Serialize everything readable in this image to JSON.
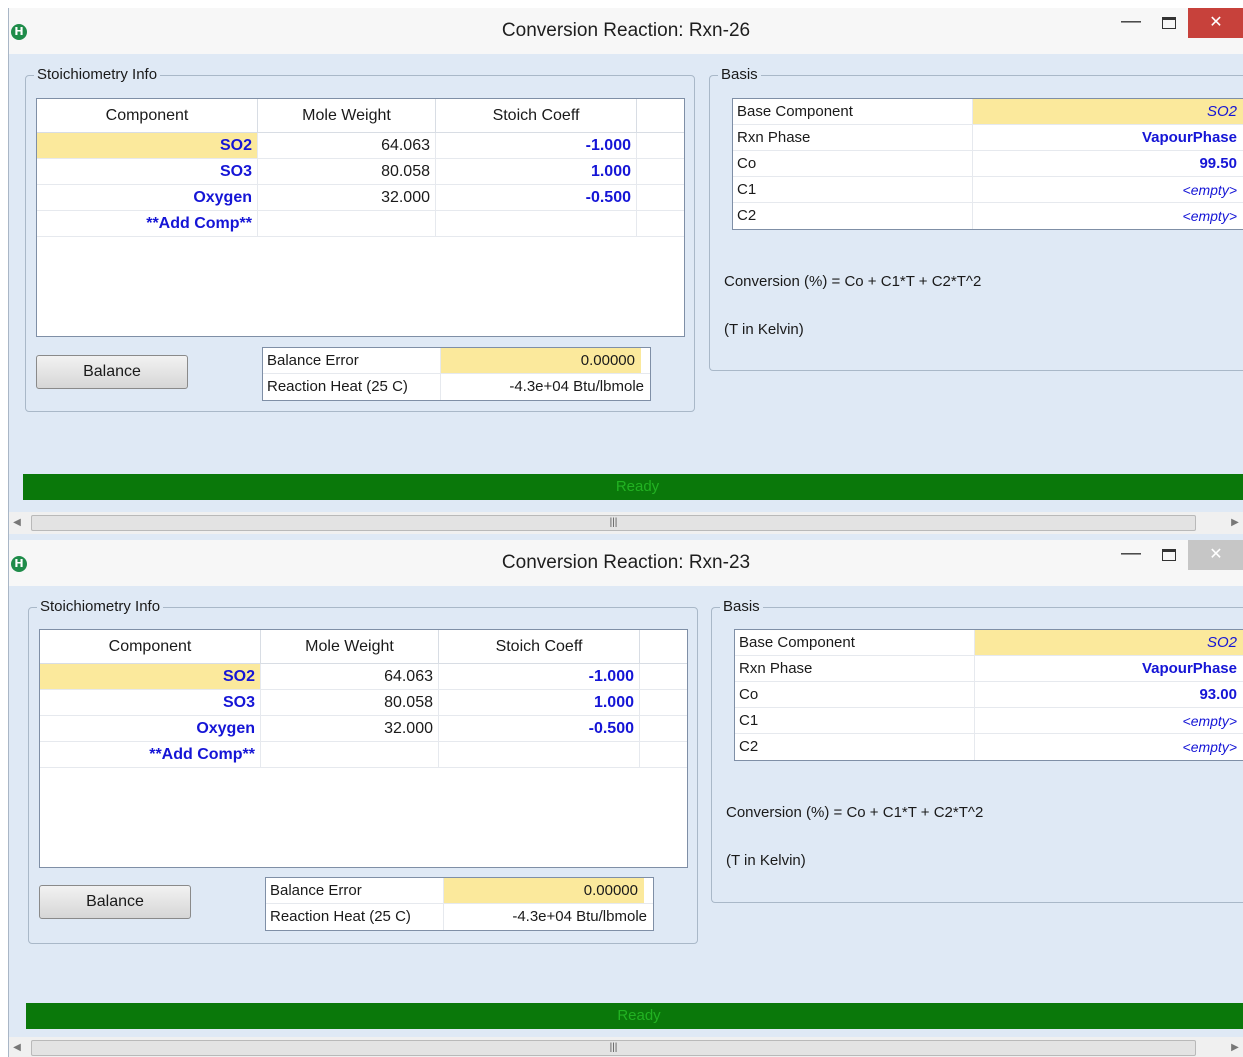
{
  "window1": {
    "title": "Conversion Reaction: Rxn-26",
    "stoich_label": "Stoichiometry Info",
    "grid_headers": [
      "Component",
      "Mole Weight",
      "Stoich Coeff"
    ],
    "rows": [
      {
        "component": "SO2",
        "mw": "64.063",
        "coeff": "-1.000"
      },
      {
        "component": "SO3",
        "mw": "80.058",
        "coeff": "1.000"
      },
      {
        "component": "Oxygen",
        "mw": "32.000",
        "coeff": "-0.500"
      },
      {
        "component": "**Add Comp**",
        "mw": "",
        "coeff": ""
      }
    ],
    "balance_button": "Balance",
    "balance_error_label": "Balance Error",
    "balance_error_value": "0.00000",
    "reaction_heat_label": "Reaction Heat (25 C)",
    "reaction_heat_value": "-4.3e+04 Btu/lbmole",
    "basis_label": "Basis",
    "basis": {
      "base_component_label": "Base Component",
      "base_component_value": "SO2",
      "rxn_phase_label": "Rxn Phase",
      "rxn_phase_value": "VapourPhase",
      "co_label": "Co",
      "co_value": "99.50",
      "c1_label": "C1",
      "c1_value": "<empty>",
      "c2_label": "C2",
      "c2_value": "<empty>"
    },
    "formula": "Conversion (%) = Co + C1*T + C2*T^2",
    "t_note": "(T in Kelvin)",
    "status": "Ready"
  },
  "window2": {
    "title": "Conversion Reaction: Rxn-23",
    "stoich_label": "Stoichiometry Info",
    "grid_headers": [
      "Component",
      "Mole Weight",
      "Stoich Coeff"
    ],
    "rows": [
      {
        "component": "SO2",
        "mw": "64.063",
        "coeff": "-1.000"
      },
      {
        "component": "SO3",
        "mw": "80.058",
        "coeff": "1.000"
      },
      {
        "component": "Oxygen",
        "mw": "32.000",
        "coeff": "-0.500"
      },
      {
        "component": "**Add Comp**",
        "mw": "",
        "coeff": ""
      }
    ],
    "balance_button": "Balance",
    "balance_error_label": "Balance Error",
    "balance_error_value": "0.00000",
    "reaction_heat_label": "Reaction Heat (25 C)",
    "reaction_heat_value": "-4.3e+04 Btu/lbmole",
    "basis_label": "Basis",
    "basis": {
      "base_component_label": "Base Component",
      "base_component_value": "SO2",
      "rxn_phase_label": "Rxn Phase",
      "rxn_phase_value": "VapourPhase",
      "co_label": "Co",
      "co_value": "93.00",
      "c1_label": "C1",
      "c1_value": "<empty>",
      "c2_label": "C2",
      "c2_value": "<empty>"
    },
    "formula": "Conversion (%) = Co + C1*T + C2*T^2",
    "t_note": "(T in Kelvin)",
    "status": "Ready"
  },
  "icons": {
    "app": "hysys-app-icon",
    "minimize": "minimize-icon",
    "maximize": "maximize-icon",
    "close": "close-icon"
  },
  "colors": {
    "highlight": "#fbe99c",
    "value_blue": "#1515d6",
    "status_green": "#0a780a",
    "close_red": "#c7413b",
    "client_bg": "#dfe9f5"
  }
}
